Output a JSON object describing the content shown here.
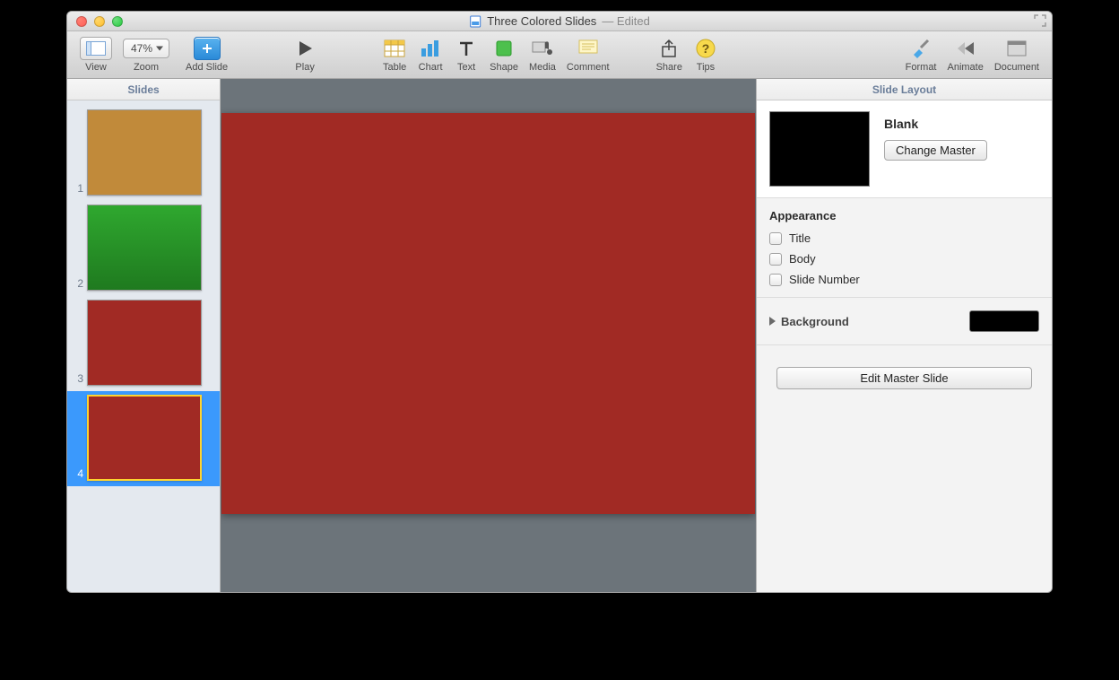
{
  "window": {
    "doc_title": "Three Colored Slides",
    "edited": "— Edited"
  },
  "toolbar": {
    "view": "View",
    "zoom": "Zoom",
    "zoom_value": "47%",
    "add_slide": "Add Slide",
    "play": "Play",
    "table": "Table",
    "chart": "Chart",
    "text": "Text",
    "shape": "Shape",
    "media": "Media",
    "comment": "Comment",
    "share": "Share",
    "tips": "Tips",
    "format": "Format",
    "animate": "Animate",
    "document": "Document"
  },
  "sidebar": {
    "header": "Slides",
    "slides": [
      {
        "num": "1",
        "color": "#c18a3a"
      },
      {
        "num": "2",
        "color": "linear-gradient(#2fa82f,#1f7a1f)"
      },
      {
        "num": "3",
        "color": "#a12a24"
      },
      {
        "num": "4",
        "color": "#a12a24"
      }
    ],
    "selected_index": 3
  },
  "canvas": {
    "slide_color": "#a12a24"
  },
  "inspector": {
    "header": "Slide Layout",
    "master_name": "Blank",
    "change_master": "Change Master",
    "appearance": "Appearance",
    "chk_title": "Title",
    "chk_body": "Body",
    "chk_slide_number": "Slide Number",
    "background": "Background",
    "bg_color": "#000000",
    "edit_master": "Edit Master Slide"
  }
}
